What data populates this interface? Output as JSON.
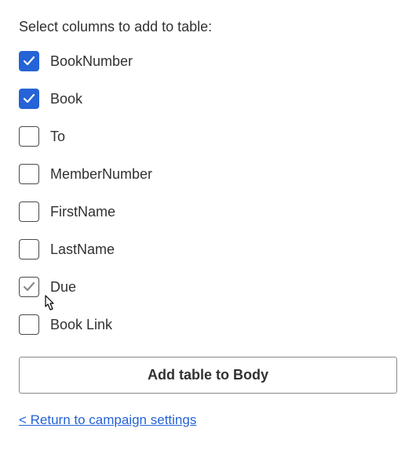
{
  "heading": "Select columns to add to table:",
  "columns": [
    {
      "label": "BookNumber",
      "checked": true,
      "hovered": false
    },
    {
      "label": "Book",
      "checked": true,
      "hovered": false
    },
    {
      "label": "To",
      "checked": false,
      "hovered": false
    },
    {
      "label": "MemberNumber",
      "checked": false,
      "hovered": false
    },
    {
      "label": "FirstName",
      "checked": false,
      "hovered": false
    },
    {
      "label": "LastName",
      "checked": false,
      "hovered": false
    },
    {
      "label": "Due",
      "checked": false,
      "hovered": true
    },
    {
      "label": "Book Link",
      "checked": false,
      "hovered": false
    }
  ],
  "add_button_label": "Add table to Body",
  "return_link_label": "< Return to campaign settings"
}
